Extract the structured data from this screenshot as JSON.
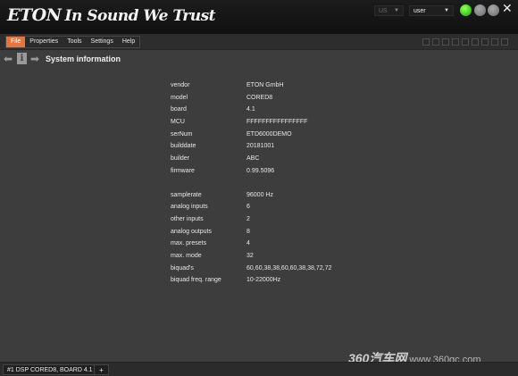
{
  "app": {
    "brand": "ETON",
    "slogan": "In Sound We Trust"
  },
  "header": {
    "language": "US",
    "user": "user",
    "close_icon": "close-icon",
    "status_colors": {
      "green": "#3ad016",
      "gray": "#6b6b6b"
    }
  },
  "menu": {
    "items": [
      {
        "label": "File",
        "active": true
      },
      {
        "label": "Properties"
      },
      {
        "label": "Tools"
      },
      {
        "label": "Settings"
      },
      {
        "label": "Help"
      }
    ],
    "accent": "#e8743c"
  },
  "toolbar": {
    "icons": [
      "back-arrow-icon",
      "info-icon",
      "forward-arrow-icon"
    ],
    "title": "System information"
  },
  "system_info": {
    "group1": [
      {
        "key": "vendor",
        "value": "ETON GmbH"
      },
      {
        "key": "model",
        "value": "CORED8"
      },
      {
        "key": "board",
        "value": "4.1"
      },
      {
        "key": "MCU",
        "value": "FFFFFFFFFFFFFFFF"
      },
      {
        "key": "serNum",
        "value": "ETD6000DEMO"
      },
      {
        "key": "builddate",
        "value": "20181001"
      },
      {
        "key": "builder",
        "value": "ABC"
      },
      {
        "key": "firmware",
        "value": "0.99.5096"
      }
    ],
    "group2": [
      {
        "key": "samplerate",
        "value": "96000 Hz"
      },
      {
        "key": "analog inputs",
        "value": "6"
      },
      {
        "key": "other inputs",
        "value": "2"
      },
      {
        "key": "analog outputs",
        "value": "8"
      },
      {
        "key": "max. presets",
        "value": "4"
      },
      {
        "key": "max. mode",
        "value": "32"
      },
      {
        "key": "biquad's",
        "value": "60,60,38,38,60,60,38,38,72,72"
      },
      {
        "key": "biquad freq. range",
        "value": "10-22000Hz"
      }
    ]
  },
  "bottom": {
    "device_tab": "#1 DSP CORED8, BOARD 4.1",
    "add_tab": "+"
  },
  "watermark": {
    "logo": "360汽车网",
    "url": "www.360qc.com"
  }
}
